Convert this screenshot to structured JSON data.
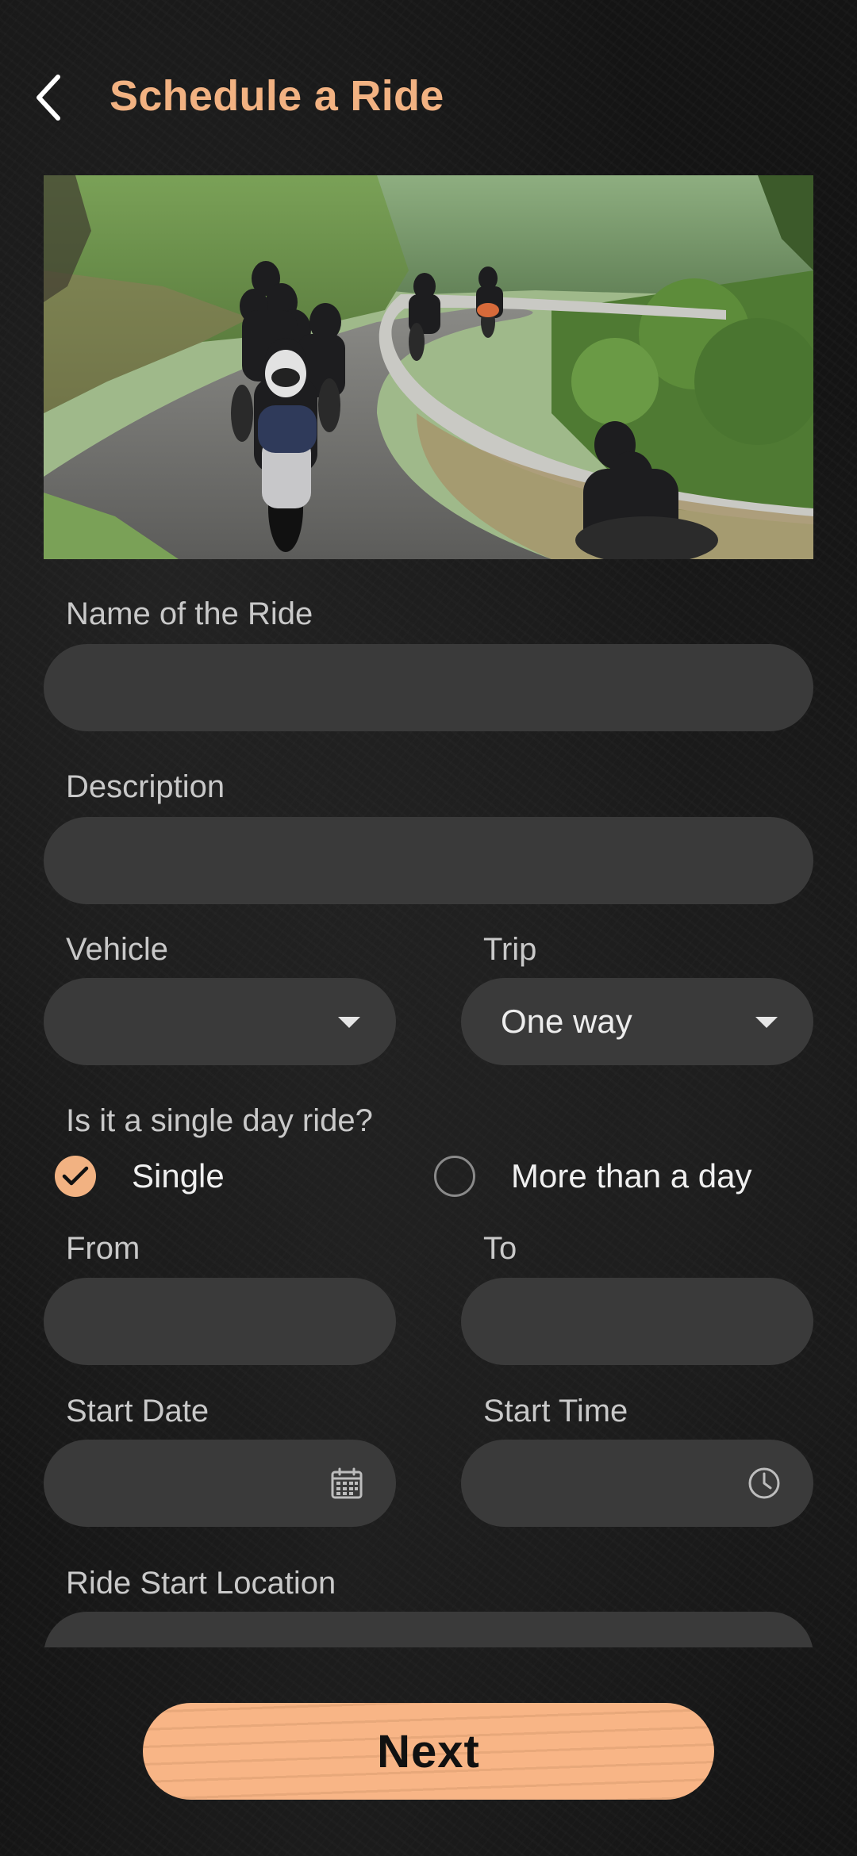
{
  "header": {
    "back_icon": "chevron-left-icon",
    "title": "Schedule a Ride"
  },
  "form": {
    "name_label": "Name of the Ride",
    "name_value": "",
    "description_label": "Description",
    "description_value": "",
    "vehicle_label": "Vehicle",
    "vehicle_value": "",
    "trip_label": "Trip",
    "trip_value": "One way",
    "single_day_question": "Is it a single day ride?",
    "options": {
      "single": "Single",
      "multi": "More than a day",
      "selected": "single"
    },
    "from_label": "From",
    "to_label": "To",
    "start_date_label": "Start Date",
    "start_time_label": "Start Time",
    "start_location_label": "Ride Start Location"
  },
  "actions": {
    "next_label": "Next"
  },
  "colors": {
    "accent": "#F2B282",
    "field_bg": "#3a3a3a",
    "background": "#141414"
  }
}
